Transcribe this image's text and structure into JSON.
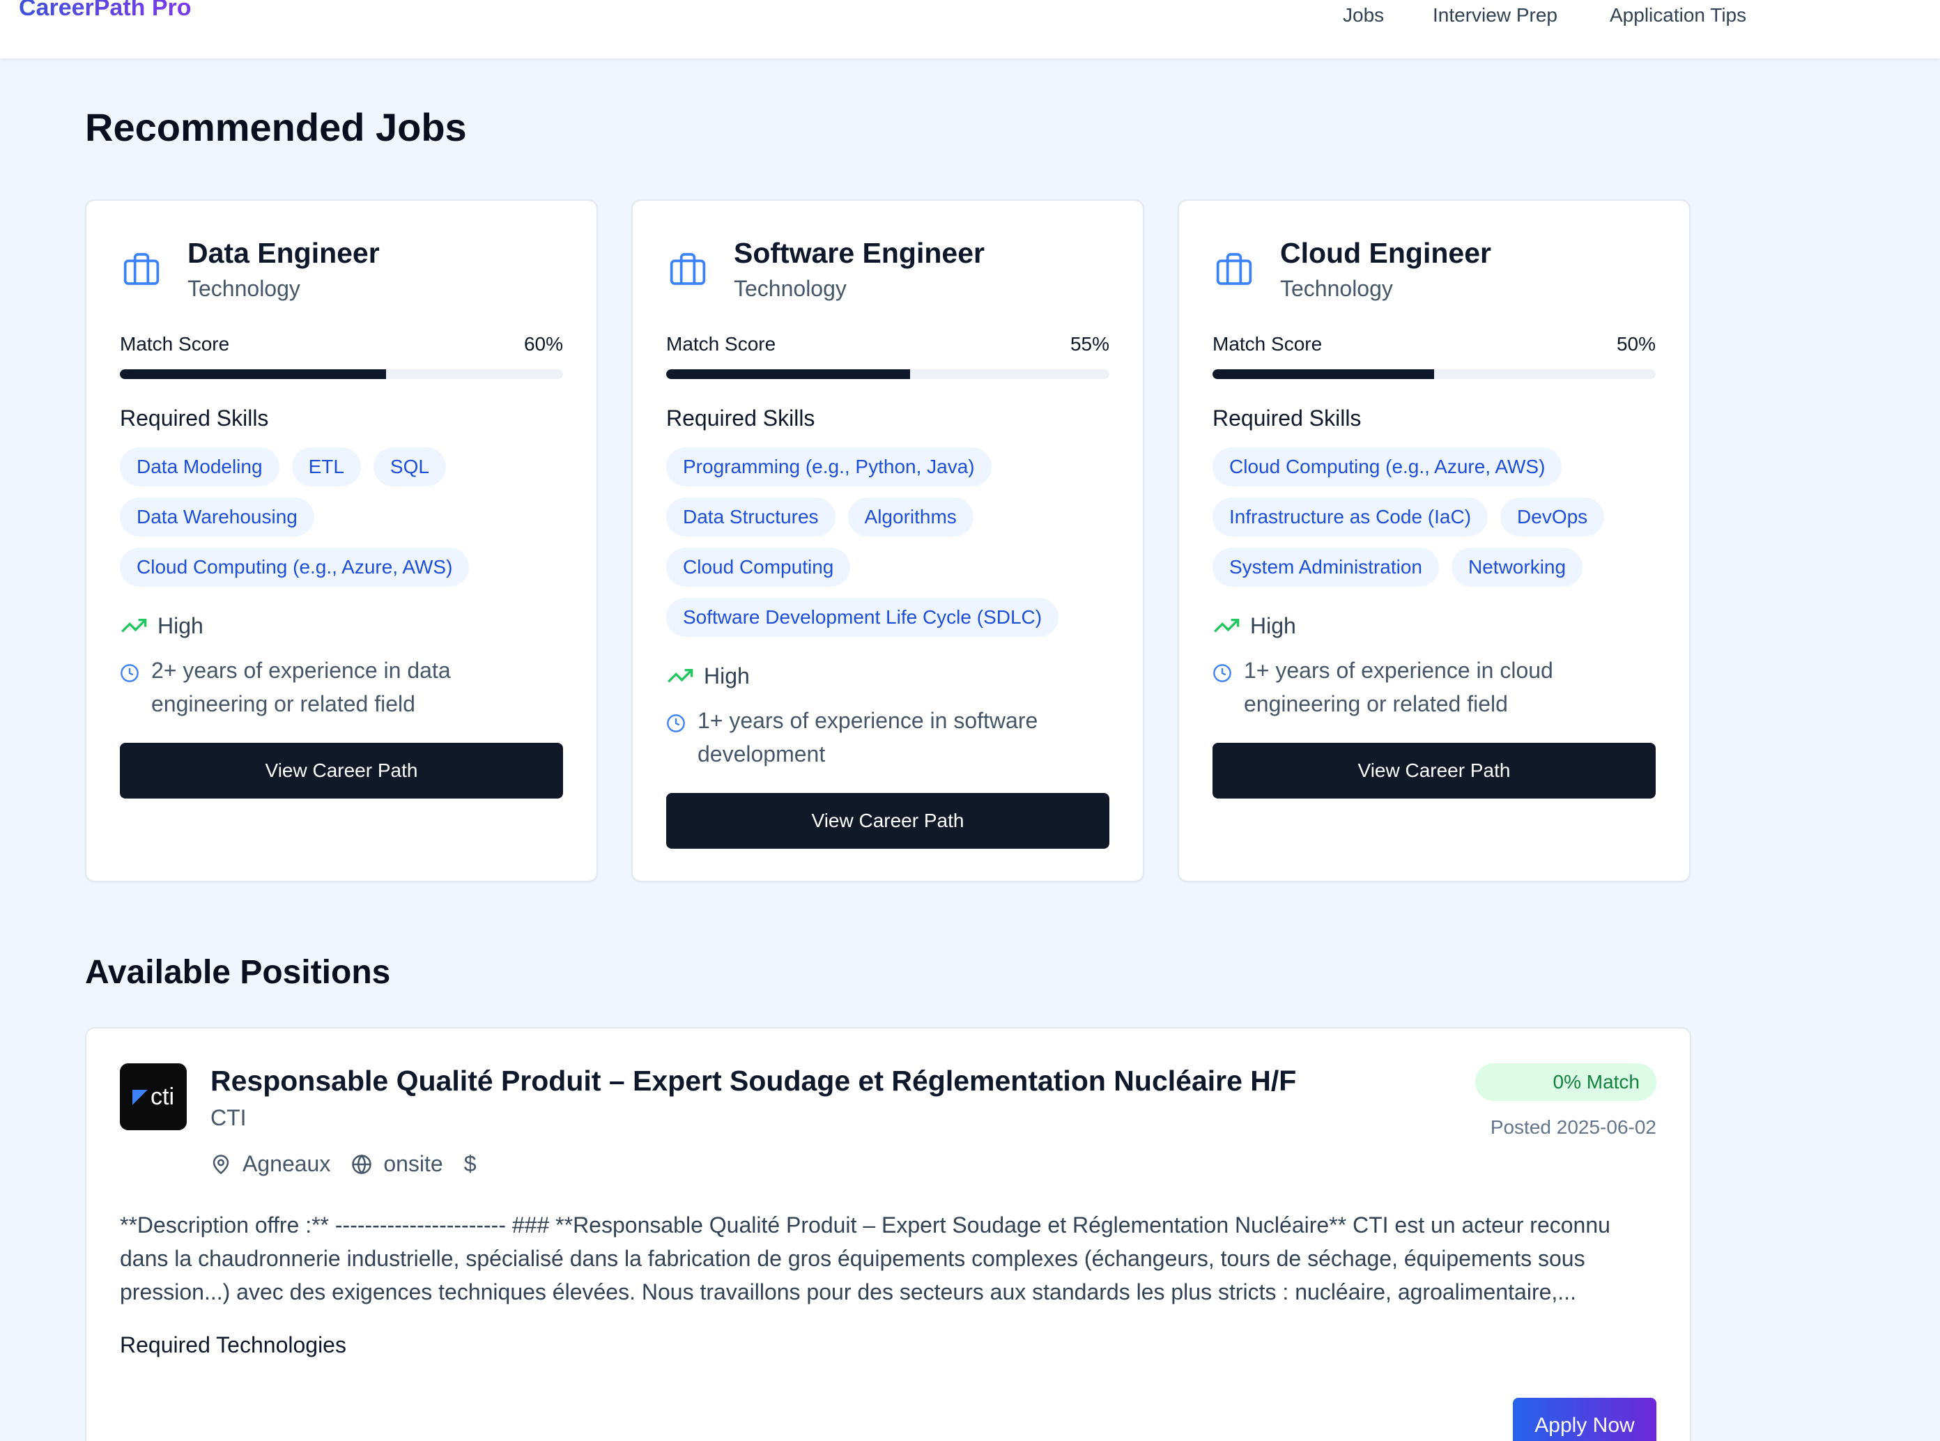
{
  "app": {
    "brand": "CareerPath Pro"
  },
  "nav": {
    "jobs": "Jobs",
    "interview_prep": "Interview Prep",
    "application_tips": "Application Tips"
  },
  "recommended": {
    "title": "Recommended Jobs",
    "match_label": "Match Score",
    "skills_label": "Required Skills",
    "button_label": "View Career Path",
    "cards": [
      {
        "title": "Data Engineer",
        "category": "Technology",
        "match": "60%",
        "match_value": 60,
        "skills": [
          "Data Modeling",
          "ETL",
          "SQL",
          "Data Warehousing",
          "Cloud Computing (e.g., Azure, AWS)"
        ],
        "demand": "High",
        "experience": "2+ years of experience in data engineering or related field"
      },
      {
        "title": "Software Engineer",
        "category": "Technology",
        "match": "55%",
        "match_value": 55,
        "skills": [
          "Programming (e.g., Python, Java)",
          "Data Structures",
          "Algorithms",
          "Cloud Computing",
          "Software Development Life Cycle (SDLC)"
        ],
        "demand": "High",
        "experience": "1+ years of experience in software development"
      },
      {
        "title": "Cloud Engineer",
        "category": "Technology",
        "match": "50%",
        "match_value": 50,
        "skills": [
          "Cloud Computing (e.g., Azure, AWS)",
          "Infrastructure as Code (IaC)",
          "DevOps",
          "System Administration",
          "Networking"
        ],
        "demand": "High",
        "experience": "1+ years of experience in cloud engineering or related field"
      }
    ]
  },
  "positions": {
    "title": "Available Positions",
    "items": [
      {
        "logo_text": "cti",
        "title": "Responsable Qualité Produit – Expert Soudage et Réglementation Nucléaire H/F",
        "company": "CTI",
        "location": "Agneaux",
        "work_mode": "onsite",
        "salary_icon": "$",
        "match_badge": "0% Match",
        "posted": "Posted 2025-06-02",
        "description": "**Description offre :** ----------------------- ### **Responsable Qualité Produit – Expert Soudage et Réglementation Nucléaire** CTI est un acteur reconnu dans la chaudronnerie industrielle, spécialisé dans la fabrication de gros équipements complexes (échangeurs, tours de séchage, équipements sous pression...) avec des exigences techniques élevées. Nous travaillons pour des secteurs aux standards les plus stricts : nucléaire, agroalimentaire,...",
        "required_tech_label": "Required Technologies",
        "apply_label": "Apply Now"
      }
    ]
  },
  "colors": {
    "accent": "#1d4ed8",
    "dark": "#111827",
    "brand_from": "#3f51d9",
    "brand_to": "#7c3aed",
    "trend_green": "#22c55e"
  }
}
